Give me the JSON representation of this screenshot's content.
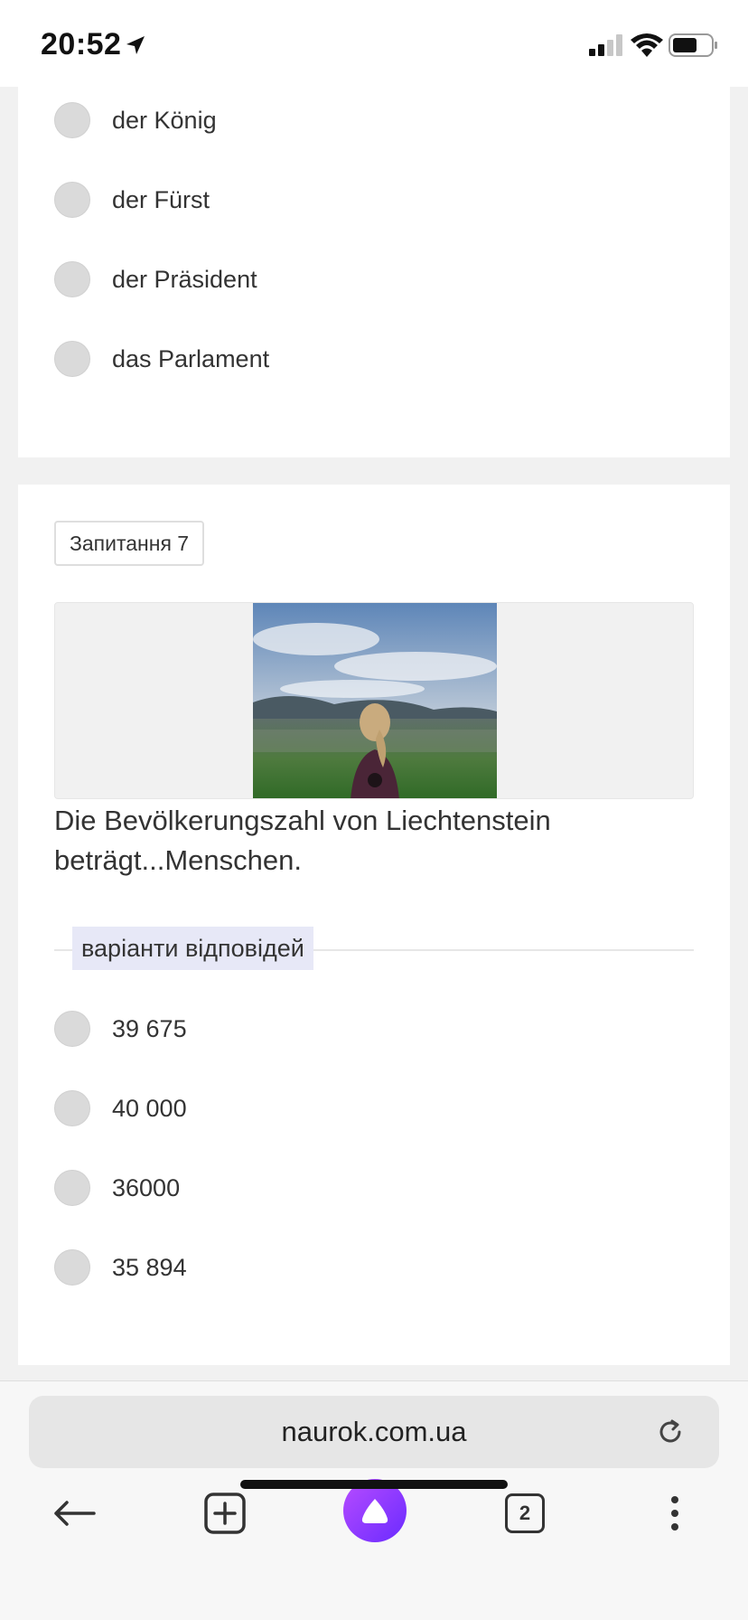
{
  "status_bar": {
    "time": "20:52",
    "icons": [
      "location-arrow-icon",
      "cellular-signal-icon",
      "wifi-icon",
      "battery-icon"
    ]
  },
  "previous_question": {
    "options": [
      {
        "label": "der König"
      },
      {
        "label": "der Fürst"
      },
      {
        "label": "der Präsident"
      },
      {
        "label": "das Parlament"
      }
    ]
  },
  "question": {
    "badge": "Запитання 7",
    "text": "Die Bevölkerungszahl von Liechtenstein beträgt...Menschen.",
    "answers_label": "варіанти відповідей",
    "options": [
      {
        "label": "39 675"
      },
      {
        "label": "40 000"
      },
      {
        "label": "36000"
      },
      {
        "label": "35 894"
      }
    ]
  },
  "browser": {
    "url": "naurok.com.ua",
    "tabs_count": "2",
    "icons": [
      "back-arrow-icon",
      "new-tab-icon",
      "alice-assistant-icon",
      "tabs-icon",
      "more-menu-icon",
      "reload-icon"
    ]
  },
  "colors": {
    "page_bg": "#f1f1f1",
    "radio": "#dadada",
    "answers_label_bg": "#e7e8f7",
    "assistant_gradient": [
      "#b84cff",
      "#6a2bff"
    ]
  }
}
